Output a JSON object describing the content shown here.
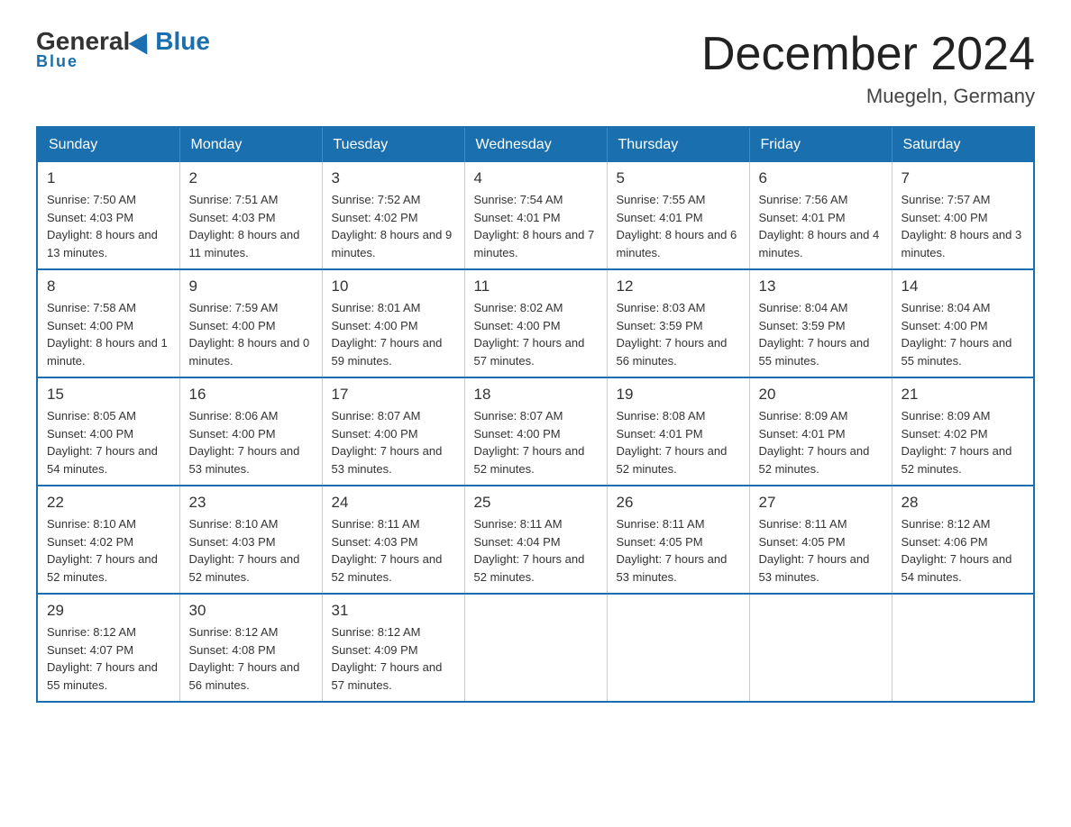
{
  "logo": {
    "general": "General",
    "blue": "Blue"
  },
  "title": "December 2024",
  "location": "Muegeln, Germany",
  "days_of_week": [
    "Sunday",
    "Monday",
    "Tuesday",
    "Wednesday",
    "Thursday",
    "Friday",
    "Saturday"
  ],
  "weeks": [
    [
      {
        "day": "1",
        "sunrise": "7:50 AM",
        "sunset": "4:03 PM",
        "daylight": "8 hours and 13 minutes."
      },
      {
        "day": "2",
        "sunrise": "7:51 AM",
        "sunset": "4:03 PM",
        "daylight": "8 hours and 11 minutes."
      },
      {
        "day": "3",
        "sunrise": "7:52 AM",
        "sunset": "4:02 PM",
        "daylight": "8 hours and 9 minutes."
      },
      {
        "day": "4",
        "sunrise": "7:54 AM",
        "sunset": "4:01 PM",
        "daylight": "8 hours and 7 minutes."
      },
      {
        "day": "5",
        "sunrise": "7:55 AM",
        "sunset": "4:01 PM",
        "daylight": "8 hours and 6 minutes."
      },
      {
        "day": "6",
        "sunrise": "7:56 AM",
        "sunset": "4:01 PM",
        "daylight": "8 hours and 4 minutes."
      },
      {
        "day": "7",
        "sunrise": "7:57 AM",
        "sunset": "4:00 PM",
        "daylight": "8 hours and 3 minutes."
      }
    ],
    [
      {
        "day": "8",
        "sunrise": "7:58 AM",
        "sunset": "4:00 PM",
        "daylight": "8 hours and 1 minute."
      },
      {
        "day": "9",
        "sunrise": "7:59 AM",
        "sunset": "4:00 PM",
        "daylight": "8 hours and 0 minutes."
      },
      {
        "day": "10",
        "sunrise": "8:01 AM",
        "sunset": "4:00 PM",
        "daylight": "7 hours and 59 minutes."
      },
      {
        "day": "11",
        "sunrise": "8:02 AM",
        "sunset": "4:00 PM",
        "daylight": "7 hours and 57 minutes."
      },
      {
        "day": "12",
        "sunrise": "8:03 AM",
        "sunset": "3:59 PM",
        "daylight": "7 hours and 56 minutes."
      },
      {
        "day": "13",
        "sunrise": "8:04 AM",
        "sunset": "3:59 PM",
        "daylight": "7 hours and 55 minutes."
      },
      {
        "day": "14",
        "sunrise": "8:04 AM",
        "sunset": "4:00 PM",
        "daylight": "7 hours and 55 minutes."
      }
    ],
    [
      {
        "day": "15",
        "sunrise": "8:05 AM",
        "sunset": "4:00 PM",
        "daylight": "7 hours and 54 minutes."
      },
      {
        "day": "16",
        "sunrise": "8:06 AM",
        "sunset": "4:00 PM",
        "daylight": "7 hours and 53 minutes."
      },
      {
        "day": "17",
        "sunrise": "8:07 AM",
        "sunset": "4:00 PM",
        "daylight": "7 hours and 53 minutes."
      },
      {
        "day": "18",
        "sunrise": "8:07 AM",
        "sunset": "4:00 PM",
        "daylight": "7 hours and 52 minutes."
      },
      {
        "day": "19",
        "sunrise": "8:08 AM",
        "sunset": "4:01 PM",
        "daylight": "7 hours and 52 minutes."
      },
      {
        "day": "20",
        "sunrise": "8:09 AM",
        "sunset": "4:01 PM",
        "daylight": "7 hours and 52 minutes."
      },
      {
        "day": "21",
        "sunrise": "8:09 AM",
        "sunset": "4:02 PM",
        "daylight": "7 hours and 52 minutes."
      }
    ],
    [
      {
        "day": "22",
        "sunrise": "8:10 AM",
        "sunset": "4:02 PM",
        "daylight": "7 hours and 52 minutes."
      },
      {
        "day": "23",
        "sunrise": "8:10 AM",
        "sunset": "4:03 PM",
        "daylight": "7 hours and 52 minutes."
      },
      {
        "day": "24",
        "sunrise": "8:11 AM",
        "sunset": "4:03 PM",
        "daylight": "7 hours and 52 minutes."
      },
      {
        "day": "25",
        "sunrise": "8:11 AM",
        "sunset": "4:04 PM",
        "daylight": "7 hours and 52 minutes."
      },
      {
        "day": "26",
        "sunrise": "8:11 AM",
        "sunset": "4:05 PM",
        "daylight": "7 hours and 53 minutes."
      },
      {
        "day": "27",
        "sunrise": "8:11 AM",
        "sunset": "4:05 PM",
        "daylight": "7 hours and 53 minutes."
      },
      {
        "day": "28",
        "sunrise": "8:12 AM",
        "sunset": "4:06 PM",
        "daylight": "7 hours and 54 minutes."
      }
    ],
    [
      {
        "day": "29",
        "sunrise": "8:12 AM",
        "sunset": "4:07 PM",
        "daylight": "7 hours and 55 minutes."
      },
      {
        "day": "30",
        "sunrise": "8:12 AM",
        "sunset": "4:08 PM",
        "daylight": "7 hours and 56 minutes."
      },
      {
        "day": "31",
        "sunrise": "8:12 AM",
        "sunset": "4:09 PM",
        "daylight": "7 hours and 57 minutes."
      },
      null,
      null,
      null,
      null
    ]
  ]
}
